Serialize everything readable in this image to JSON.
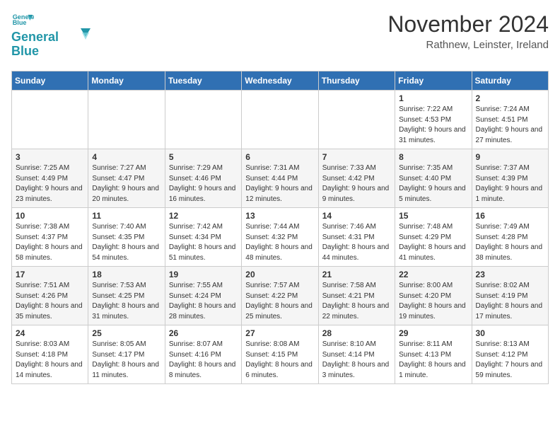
{
  "header": {
    "logo_line1": "General",
    "logo_line2": "Blue",
    "month": "November 2024",
    "location": "Rathnew, Leinster, Ireland"
  },
  "days_of_week": [
    "Sunday",
    "Monday",
    "Tuesday",
    "Wednesday",
    "Thursday",
    "Friday",
    "Saturday"
  ],
  "weeks": [
    [
      {
        "day": "",
        "content": ""
      },
      {
        "day": "",
        "content": ""
      },
      {
        "day": "",
        "content": ""
      },
      {
        "day": "",
        "content": ""
      },
      {
        "day": "",
        "content": ""
      },
      {
        "day": "1",
        "content": "Sunrise: 7:22 AM\nSunset: 4:53 PM\nDaylight: 9 hours and 31 minutes."
      },
      {
        "day": "2",
        "content": "Sunrise: 7:24 AM\nSunset: 4:51 PM\nDaylight: 9 hours and 27 minutes."
      }
    ],
    [
      {
        "day": "3",
        "content": "Sunrise: 7:25 AM\nSunset: 4:49 PM\nDaylight: 9 hours and 23 minutes."
      },
      {
        "day": "4",
        "content": "Sunrise: 7:27 AM\nSunset: 4:47 PM\nDaylight: 9 hours and 20 minutes."
      },
      {
        "day": "5",
        "content": "Sunrise: 7:29 AM\nSunset: 4:46 PM\nDaylight: 9 hours and 16 minutes."
      },
      {
        "day": "6",
        "content": "Sunrise: 7:31 AM\nSunset: 4:44 PM\nDaylight: 9 hours and 12 minutes."
      },
      {
        "day": "7",
        "content": "Sunrise: 7:33 AM\nSunset: 4:42 PM\nDaylight: 9 hours and 9 minutes."
      },
      {
        "day": "8",
        "content": "Sunrise: 7:35 AM\nSunset: 4:40 PM\nDaylight: 9 hours and 5 minutes."
      },
      {
        "day": "9",
        "content": "Sunrise: 7:37 AM\nSunset: 4:39 PM\nDaylight: 9 hours and 1 minute."
      }
    ],
    [
      {
        "day": "10",
        "content": "Sunrise: 7:38 AM\nSunset: 4:37 PM\nDaylight: 8 hours and 58 minutes."
      },
      {
        "day": "11",
        "content": "Sunrise: 7:40 AM\nSunset: 4:35 PM\nDaylight: 8 hours and 54 minutes."
      },
      {
        "day": "12",
        "content": "Sunrise: 7:42 AM\nSunset: 4:34 PM\nDaylight: 8 hours and 51 minutes."
      },
      {
        "day": "13",
        "content": "Sunrise: 7:44 AM\nSunset: 4:32 PM\nDaylight: 8 hours and 48 minutes."
      },
      {
        "day": "14",
        "content": "Sunrise: 7:46 AM\nSunset: 4:31 PM\nDaylight: 8 hours and 44 minutes."
      },
      {
        "day": "15",
        "content": "Sunrise: 7:48 AM\nSunset: 4:29 PM\nDaylight: 8 hours and 41 minutes."
      },
      {
        "day": "16",
        "content": "Sunrise: 7:49 AM\nSunset: 4:28 PM\nDaylight: 8 hours and 38 minutes."
      }
    ],
    [
      {
        "day": "17",
        "content": "Sunrise: 7:51 AM\nSunset: 4:26 PM\nDaylight: 8 hours and 35 minutes."
      },
      {
        "day": "18",
        "content": "Sunrise: 7:53 AM\nSunset: 4:25 PM\nDaylight: 8 hours and 31 minutes."
      },
      {
        "day": "19",
        "content": "Sunrise: 7:55 AM\nSunset: 4:24 PM\nDaylight: 8 hours and 28 minutes."
      },
      {
        "day": "20",
        "content": "Sunrise: 7:57 AM\nSunset: 4:22 PM\nDaylight: 8 hours and 25 minutes."
      },
      {
        "day": "21",
        "content": "Sunrise: 7:58 AM\nSunset: 4:21 PM\nDaylight: 8 hours and 22 minutes."
      },
      {
        "day": "22",
        "content": "Sunrise: 8:00 AM\nSunset: 4:20 PM\nDaylight: 8 hours and 19 minutes."
      },
      {
        "day": "23",
        "content": "Sunrise: 8:02 AM\nSunset: 4:19 PM\nDaylight: 8 hours and 17 minutes."
      }
    ],
    [
      {
        "day": "24",
        "content": "Sunrise: 8:03 AM\nSunset: 4:18 PM\nDaylight: 8 hours and 14 minutes."
      },
      {
        "day": "25",
        "content": "Sunrise: 8:05 AM\nSunset: 4:17 PM\nDaylight: 8 hours and 11 minutes."
      },
      {
        "day": "26",
        "content": "Sunrise: 8:07 AM\nSunset: 4:16 PM\nDaylight: 8 hours and 8 minutes."
      },
      {
        "day": "27",
        "content": "Sunrise: 8:08 AM\nSunset: 4:15 PM\nDaylight: 8 hours and 6 minutes."
      },
      {
        "day": "28",
        "content": "Sunrise: 8:10 AM\nSunset: 4:14 PM\nDaylight: 8 hours and 3 minutes."
      },
      {
        "day": "29",
        "content": "Sunrise: 8:11 AM\nSunset: 4:13 PM\nDaylight: 8 hours and 1 minute."
      },
      {
        "day": "30",
        "content": "Sunrise: 8:13 AM\nSunset: 4:12 PM\nDaylight: 7 hours and 59 minutes."
      }
    ]
  ]
}
